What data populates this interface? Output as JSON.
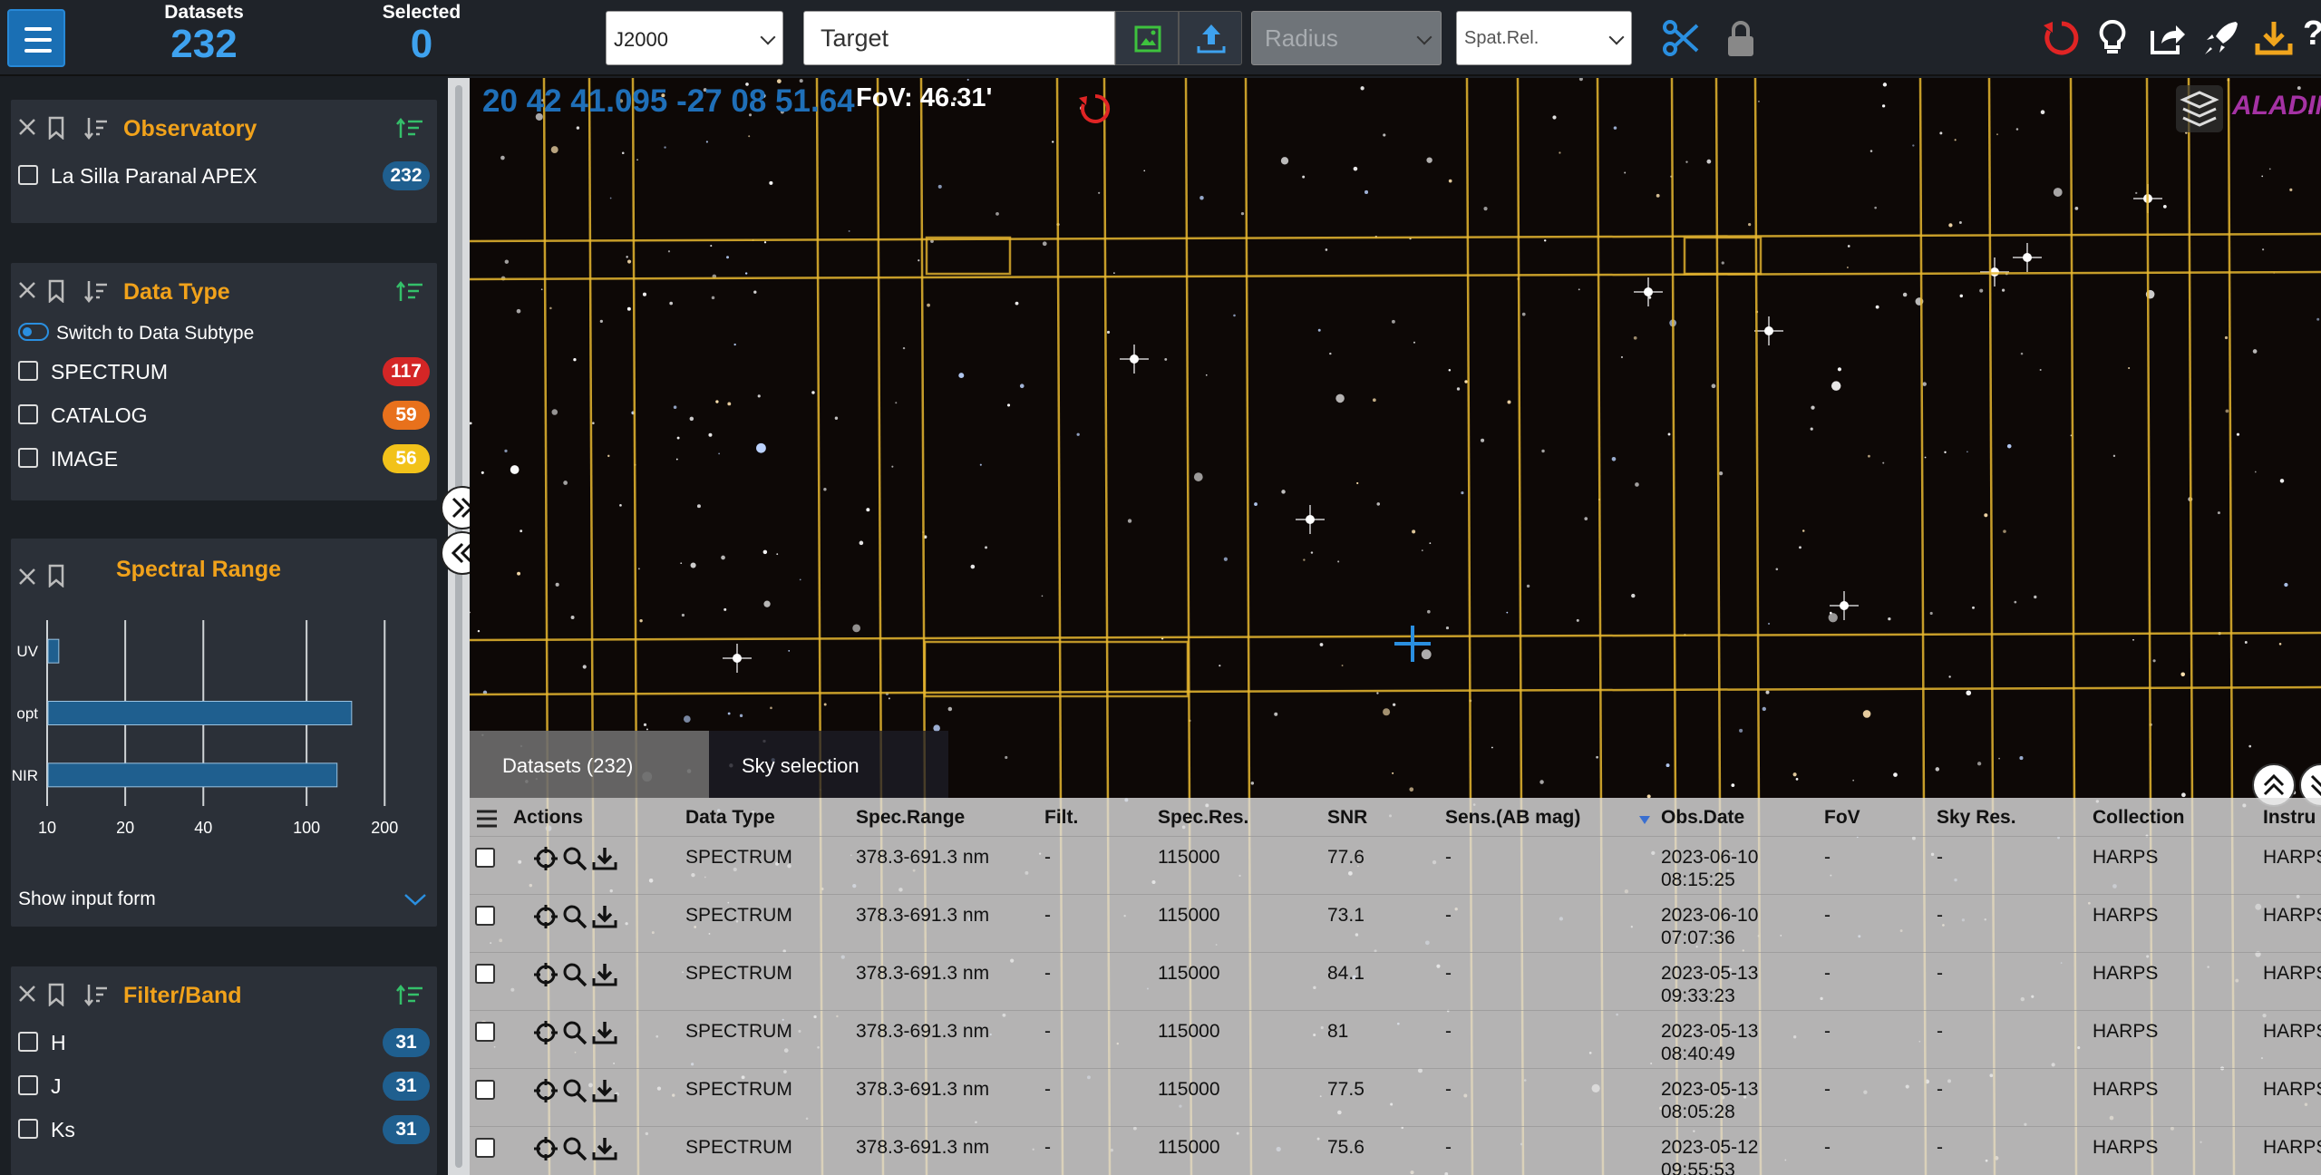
{
  "topbar": {
    "datasets_label": "Datasets",
    "datasets_count": "232",
    "selected_label": "Selected",
    "selected_count": "0",
    "frame_select": "J2000",
    "target_placeholder": "Target",
    "radius_placeholder": "Radius",
    "spatial_relation": "Spat.Rel."
  },
  "filters": {
    "observatory": {
      "title": "Observatory",
      "items": [
        {
          "label": "La Silla Paranal APEX",
          "count": "232"
        }
      ]
    },
    "data_type": {
      "title": "Data Type",
      "switch_label": "Switch to Data Subtype",
      "items": [
        {
          "label": "SPECTRUM",
          "count": "117"
        },
        {
          "label": "CATALOG",
          "count": "59"
        },
        {
          "label": "IMAGE",
          "count": "56"
        }
      ]
    },
    "spectral_range": {
      "title": "Spectral Range",
      "show_input_form": "Show input form"
    },
    "filter_band": {
      "title": "Filter/Band",
      "items": [
        {
          "label": "H",
          "count": "31"
        },
        {
          "label": "J",
          "count": "31"
        },
        {
          "label": "Ks",
          "count": "31"
        }
      ]
    }
  },
  "chart_data": {
    "type": "bar",
    "orientation": "horizontal",
    "title": "Spectral Range",
    "xscale": "log",
    "categories": [
      "UV",
      "opt",
      "NIR"
    ],
    "values": [
      11,
      148,
      130
    ],
    "xlim": [
      10,
      250
    ],
    "xticks": [
      10,
      20,
      40,
      100,
      200
    ],
    "xtick_labels": [
      "10",
      "20",
      "40",
      "100",
      "200"
    ],
    "grid": true,
    "color": "#1f5f8f"
  },
  "sky": {
    "coordinates": "20 42 41.095 -27 08 51.64",
    "fov": "FoV: 46.31'",
    "aladin_label": "ALADIN"
  },
  "results": {
    "tabs": [
      "Datasets (232)",
      "Sky selection"
    ],
    "columns": [
      "Actions",
      "Data Type",
      "Spec.Range",
      "Filt.",
      "Spec.Res.",
      "SNR",
      "Sens.(AB mag)",
      "Obs.Date",
      "FoV",
      "Sky Res.",
      "Collection",
      "Instru"
    ],
    "rows": [
      {
        "type": "SPECTRUM",
        "range": "378.3-691.3 nm",
        "filt": "-",
        "res": "115000",
        "snr": "77.6",
        "sens": "-",
        "date1": "2023-06-10",
        "date2": "08:15:25",
        "fov": "-",
        "skyres": "-",
        "collection": "HARPS",
        "instr": "HARPS"
      },
      {
        "type": "SPECTRUM",
        "range": "378.3-691.3 nm",
        "filt": "-",
        "res": "115000",
        "snr": "73.1",
        "sens": "-",
        "date1": "2023-06-10",
        "date2": "07:07:36",
        "fov": "-",
        "skyres": "-",
        "collection": "HARPS",
        "instr": "HARPS"
      },
      {
        "type": "SPECTRUM",
        "range": "378.3-691.3 nm",
        "filt": "-",
        "res": "115000",
        "snr": "84.1",
        "sens": "-",
        "date1": "2023-05-13",
        "date2": "09:33:23",
        "fov": "-",
        "skyres": "-",
        "collection": "HARPS",
        "instr": "HARPS"
      },
      {
        "type": "SPECTRUM",
        "range": "378.3-691.3 nm",
        "filt": "-",
        "res": "115000",
        "snr": "81",
        "sens": "-",
        "date1": "2023-05-13",
        "date2": "08:40:49",
        "fov": "-",
        "skyres": "-",
        "collection": "HARPS",
        "instr": "HARPS"
      },
      {
        "type": "SPECTRUM",
        "range": "378.3-691.3 nm",
        "filt": "-",
        "res": "115000",
        "snr": "77.5",
        "sens": "-",
        "date1": "2023-05-13",
        "date2": "08:05:28",
        "fov": "-",
        "skyres": "-",
        "collection": "HARPS",
        "instr": "HARPS"
      },
      {
        "type": "SPECTRUM",
        "range": "378.3-691.3 nm",
        "filt": "-",
        "res": "115000",
        "snr": "75.6",
        "sens": "-",
        "date1": "2023-05-12",
        "date2": "09:55:53",
        "fov": "-",
        "skyres": "-",
        "collection": "HARPS",
        "instr": "HARPS"
      }
    ]
  },
  "colors": {
    "accent_blue": "#3ea2ef",
    "title_orange": "#f1a21b",
    "badge_blue": "#1f5f8f",
    "badge_red": "#d42626",
    "badge_orange": "#e8711c",
    "badge_yellow": "#f2c21a",
    "grid_yellow": "#e7b730"
  }
}
